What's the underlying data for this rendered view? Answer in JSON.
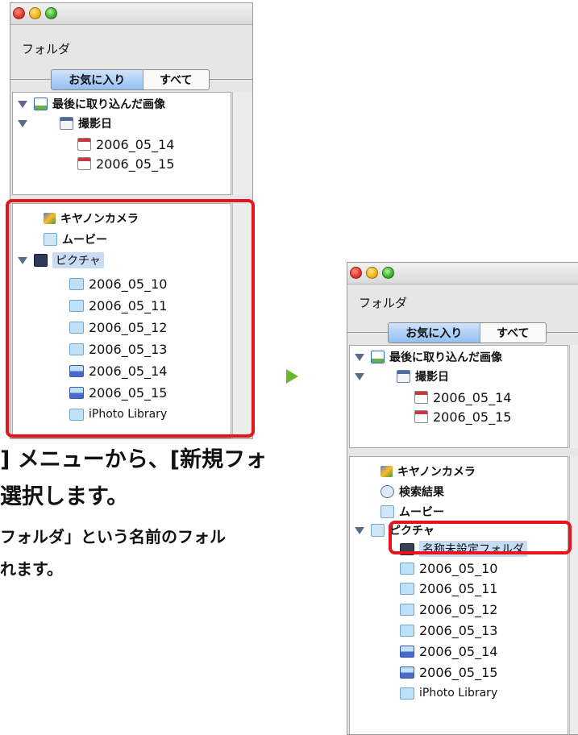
{
  "window_left": {
    "folder_label": "フォルダ",
    "tabs": [
      "お気に入り",
      "すべて"
    ],
    "top_items": [
      {
        "label": "最後に取り込んだ画像",
        "icon": "import-icon"
      },
      {
        "label": "撮影日",
        "icon": "shooting-date-icon"
      },
      {
        "label": "2006_05_14",
        "icon": "calendar-icon"
      },
      {
        "label": "2006_05_15",
        "icon": "calendar-icon"
      }
    ],
    "bottom_items": [
      {
        "label": "キヤノンカメラ",
        "icon": "canon-camera-icon"
      },
      {
        "label": "ムービー",
        "icon": "movie-icon"
      },
      {
        "label": "ピクチャ",
        "icon": "pictures-icon"
      },
      {
        "label": "2006_05_10",
        "icon": "folder-icon"
      },
      {
        "label": "2006_05_11",
        "icon": "folder-icon"
      },
      {
        "label": "2006_05_12",
        "icon": "folder-icon"
      },
      {
        "label": "2006_05_13",
        "icon": "folder-icon"
      },
      {
        "label": "2006_05_14",
        "icon": "download-folder-icon"
      },
      {
        "label": "2006_05_15",
        "icon": "download-folder-icon"
      },
      {
        "label": "iPhoto Library",
        "icon": "folder-icon"
      }
    ]
  },
  "window_right": {
    "folder_label": "フォルダ",
    "tabs": [
      "お気に入り",
      "すべて"
    ],
    "top_items": [
      {
        "label": "最後に取り込んだ画像",
        "icon": "import-icon"
      },
      {
        "label": "撮影日",
        "icon": "shooting-date-icon"
      },
      {
        "label": "2006_05_14",
        "icon": "calendar-icon"
      },
      {
        "label": "2006_05_15",
        "icon": "calendar-icon"
      }
    ],
    "bottom_items": [
      {
        "label": "キヤノンカメラ",
        "icon": "canon-camera-icon"
      },
      {
        "label": "検索結果",
        "icon": "search-results-icon"
      },
      {
        "label": "ムービー",
        "icon": "movie-icon"
      },
      {
        "label": "ピクチャ",
        "icon": "pictures-icon"
      },
      {
        "label": "名称未設定フォルダ",
        "icon": "new-folder-icon"
      },
      {
        "label": "2006_05_10",
        "icon": "folder-icon"
      },
      {
        "label": "2006_05_11",
        "icon": "folder-icon"
      },
      {
        "label": "2006_05_12",
        "icon": "folder-icon"
      },
      {
        "label": "2006_05_13",
        "icon": "folder-icon"
      },
      {
        "label": "2006_05_14",
        "icon": "download-folder-icon"
      },
      {
        "label": "2006_05_15",
        "icon": "download-folder-icon"
      },
      {
        "label": "iPhoto Library",
        "icon": "folder-icon"
      }
    ]
  },
  "caption": {
    "line1": "] メニューから、[新規フォ",
    "line2": "選択します。",
    "line3": "フォルダ」という名前のフォル",
    "line4": "れます。"
  },
  "colors": {
    "highlight": "#e8141d",
    "arrow": "#6bb82e",
    "selection": "#c9dcf6"
  }
}
